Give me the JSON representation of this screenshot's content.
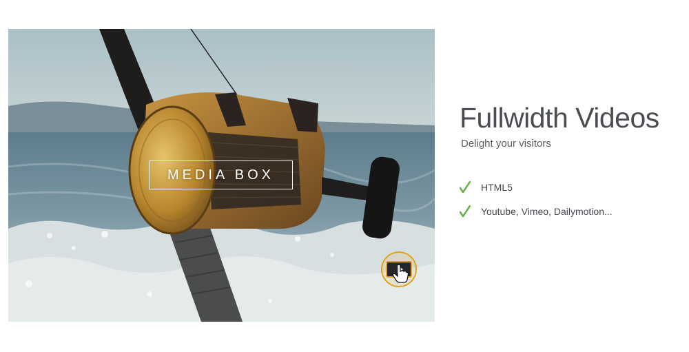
{
  "media": {
    "overlay_label": "MEDIA BOX",
    "play_icon": "play-icon",
    "cursor_icon": "hand-pointer-icon",
    "accent_color": "#e2a21c"
  },
  "content": {
    "title": "Fullwidth Videos",
    "subtitle": "Delight your visitors",
    "features": [
      {
        "label": "HTML5",
        "icon": "check-icon"
      },
      {
        "label": "Youtube, Vimeo, Dailymotion...",
        "icon": "check-icon"
      }
    ],
    "check_color": "#6ab04c",
    "title_color": "#4a4d52"
  }
}
